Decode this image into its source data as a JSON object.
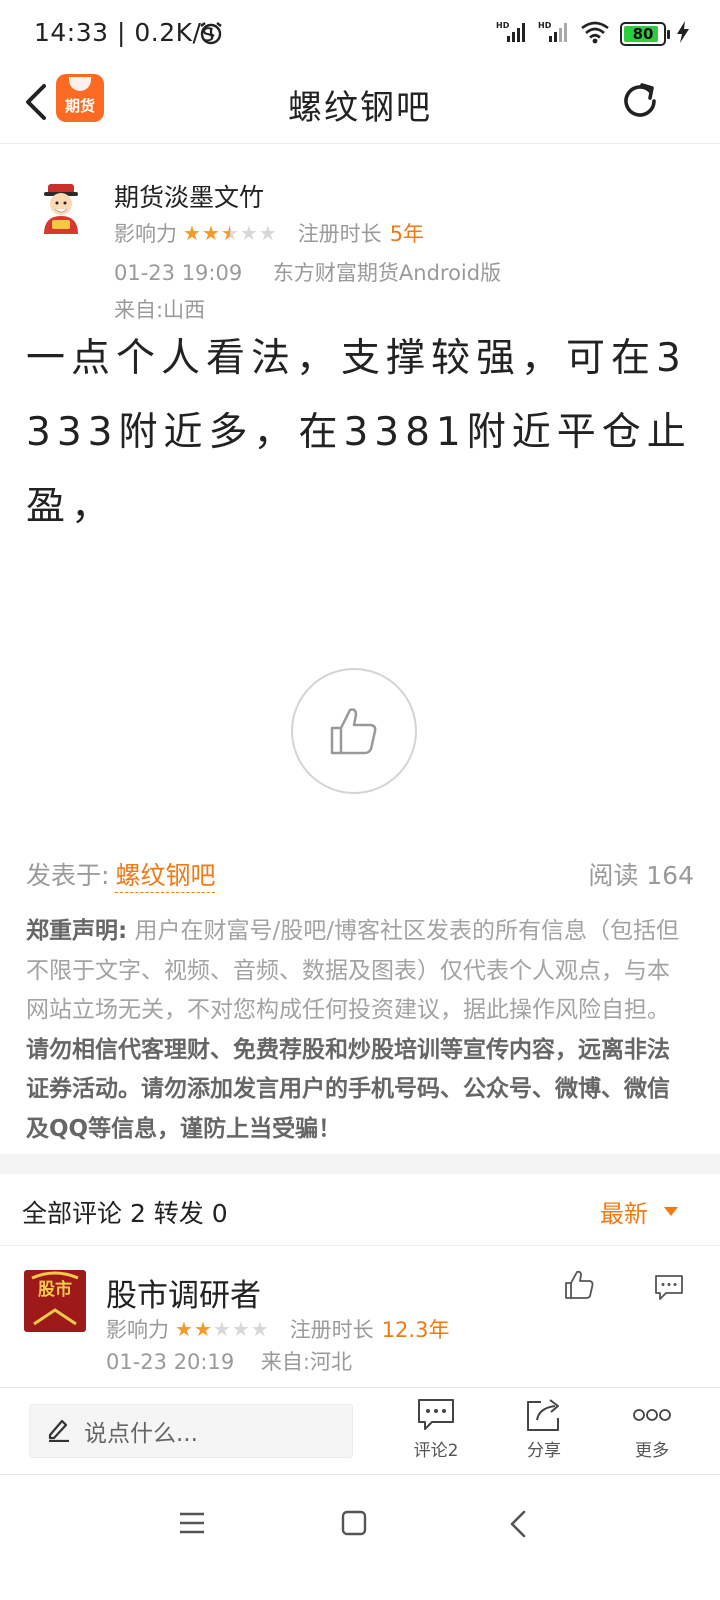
{
  "status_bar": {
    "time": "14:33 | 0.2K/s",
    "battery_level": "80",
    "icons": [
      "alarm-icon",
      "hd-signal-icon",
      "hd-signal-icon",
      "wifi-icon",
      "battery-icon",
      "charging-icon"
    ]
  },
  "nav": {
    "title": "螺纹钢吧",
    "logo_text": "期货"
  },
  "post": {
    "author_name": "期货淡墨文竹",
    "influence_label": "影响力",
    "influence_stars": 2.5,
    "reg_label": "注册时长",
    "reg_value": "5年",
    "datetime": "01-23 19:09",
    "client": "东方财富期货Android版",
    "location": "来自:山西",
    "content": "一点个人看法，支撑较强，可在3333附近多，在3381附近平仓止盈，",
    "published_label": "发表于:",
    "published_bar": "螺纹钢吧",
    "read_text": "阅读 164"
  },
  "disclaimer": {
    "title": "郑重声明:",
    "normal": " 用户在财富号/股吧/博客社区发表的所有信息（包括但不限于文字、视频、音频、数据及图表）仅代表个人观点，与本网站立场无关，不对您构成任何投资建议，据此操作风险自担。",
    "bold": "请勿相信代客理财、免费荐股和炒股培训等宣传内容，远离非法证券活动。请勿添加发言用户的手机号码、公众号、微博、微信及QQ等信息，谨防上当受骗！"
  },
  "comments_header": {
    "count_text": "全部评论 2  转发 0",
    "sort_label": "最新"
  },
  "comment": {
    "name": "股市调研者",
    "avatar_text": "股市",
    "influence_label": "影响力",
    "influence_stars": 2,
    "reg_label": "注册时长",
    "reg_value": "12.3年",
    "datetime": "01-23 20:19",
    "location": "来自:河北"
  },
  "bottom_bar": {
    "placeholder": "说点什么...",
    "comment_label": "评论2",
    "share_label": "分享",
    "more_label": "更多"
  },
  "colors": {
    "accent": "#f07a16",
    "star_on": "#f29a2a",
    "logo_bg": "#fa6a22"
  }
}
